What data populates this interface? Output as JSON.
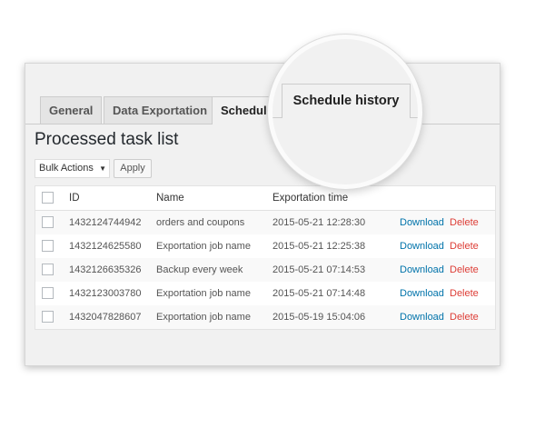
{
  "tabs": [
    {
      "label": "General"
    },
    {
      "label": "Data Exportation"
    },
    {
      "label": "Schedule h"
    }
  ],
  "magnified_tab": {
    "label": "Schedule history"
  },
  "page_title": "Processed task list",
  "bulk": {
    "selected": "Bulk Actions",
    "apply_label": "Apply"
  },
  "table": {
    "columns": {
      "id": "ID",
      "name": "Name",
      "time": "Exportation time"
    },
    "rows": [
      {
        "id": "1432124744942",
        "name": "orders and coupons",
        "time": "2015-05-21 12:28:30",
        "download": "Download",
        "delete": "Delete"
      },
      {
        "id": "1432124625580",
        "name": "Exportation job name",
        "time": "2015-05-21 12:25:38",
        "download": "Download",
        "delete": "Delete"
      },
      {
        "id": "1432126635326",
        "name": "Backup every week",
        "time": "2015-05-21 07:14:53",
        "download": "Download",
        "delete": "Delete"
      },
      {
        "id": "1432123003780",
        "name": "Exportation job name",
        "time": "2015-05-21 07:14:48",
        "download": "Download",
        "delete": "Delete"
      },
      {
        "id": "1432047828607",
        "name": "Exportation job name",
        "time": "2015-05-19 15:04:06",
        "download": "Download",
        "delete": "Delete"
      }
    ]
  },
  "colors": {
    "link": "#0073aa",
    "delete": "#dd3d36"
  }
}
